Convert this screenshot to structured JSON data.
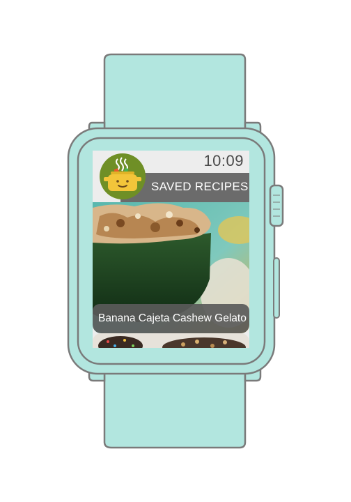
{
  "status": {
    "time": "10:09"
  },
  "header": {
    "title": "SAVED RECIPES",
    "logo_icon": "cooking-pot-icon"
  },
  "recipes": [
    {
      "title": "Banana Cajeta Cashew Gelato",
      "image": "gelato-bowl-photo"
    },
    {
      "title": "",
      "image": "sprinkle-cookies-photo"
    }
  ],
  "colors": {
    "band": "#b2e6df",
    "outline": "#7a7a7a",
    "logo_bg": "#6f8f26",
    "pot": "#f3c53a",
    "caption_bg": "#5a5a5a"
  }
}
